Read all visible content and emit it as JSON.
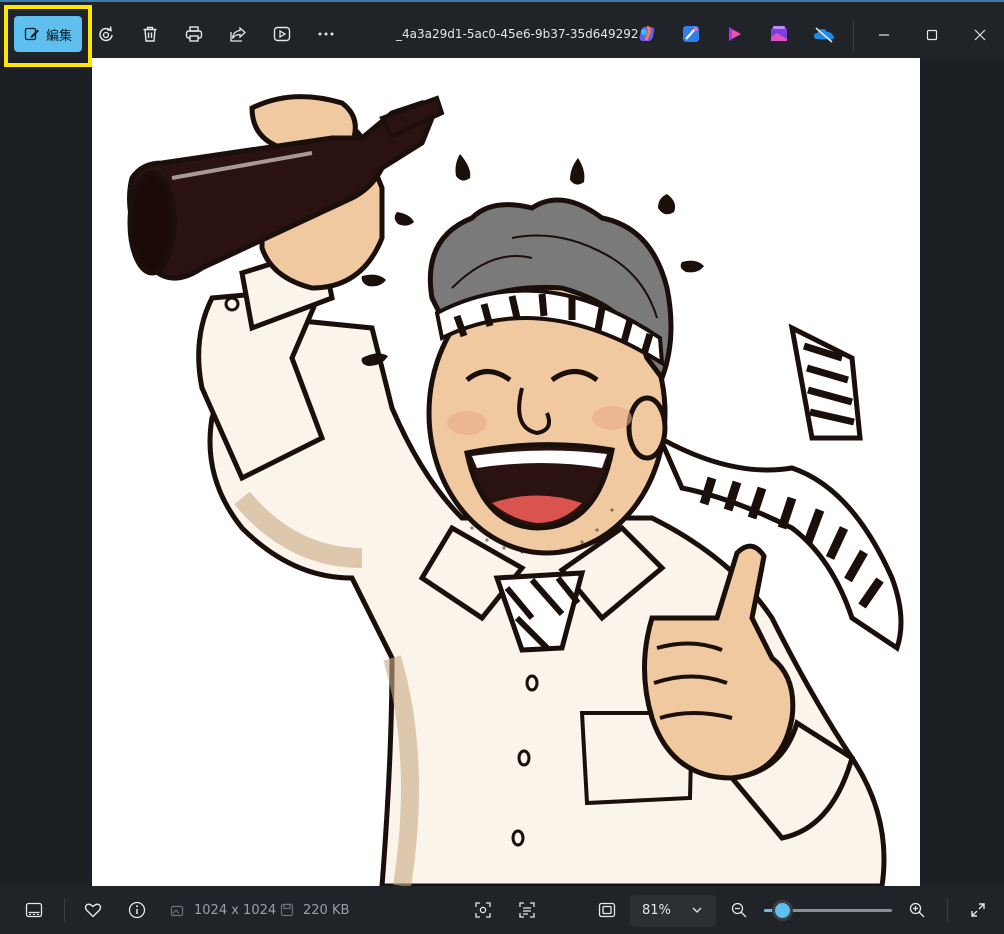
{
  "toolbar": {
    "edit_label": "編集",
    "filename": "_4a3a29d1-5ac0-45e6-9b37-35d649292...",
    "icons": [
      "edit-icon",
      "rotate-icon",
      "delete-icon",
      "print-icon",
      "share-icon",
      "slideshow-icon",
      "more-icon"
    ],
    "apps": [
      "copilot-icon",
      "designer-icon",
      "clipchamp-icon",
      "photos-icon",
      "onedrive-icon"
    ],
    "window": [
      "minimize-icon",
      "maximize-icon",
      "close-icon"
    ]
  },
  "image": {
    "description_colors": {
      "ink": "#1a0f0b",
      "skin": "#f1c9a0",
      "shirt": "#fbf4ea",
      "bottle": "#2a1210"
    }
  },
  "status": {
    "dimensions": "1024 x 1024",
    "file_size": "220 KB",
    "zoom": "81%",
    "zoom_fraction": 0.12
  },
  "colors": {
    "accent": "#5fc0f0",
    "highlight": "#ffe600",
    "bg": "#1c1f23"
  }
}
